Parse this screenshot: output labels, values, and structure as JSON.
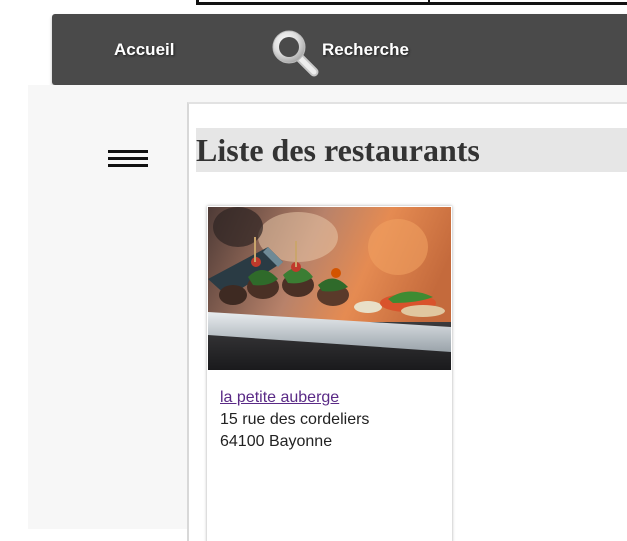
{
  "nav": {
    "home_label": "Accueil",
    "search_label": "Recherche",
    "search_icon": "search-icon"
  },
  "menu": {
    "icon": "hamburger-menu-icon"
  },
  "main": {
    "title": "Liste des restaurants",
    "restaurants": [
      {
        "name": "la petite auberge",
        "street": "15 rue des cordeliers",
        "city": "64100 Bayonne",
        "image": "restaurant-food-photo"
      }
    ]
  },
  "colors": {
    "navbar_bg": "#4a4a4a",
    "link_visited": "#5a2a86",
    "title_band": "#e6e6e6"
  }
}
